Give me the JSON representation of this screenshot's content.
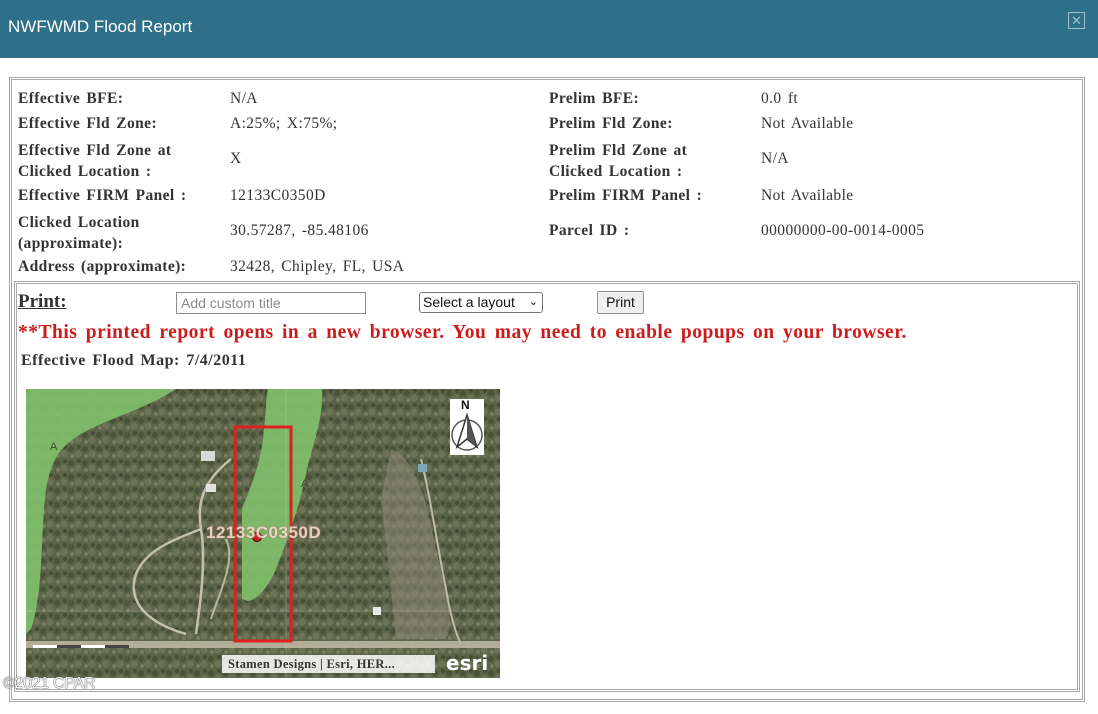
{
  "window": {
    "title": "NWFWMD Flood Report",
    "close_symbol": "✕"
  },
  "report": {
    "left": [
      {
        "label": "Effective BFE:",
        "value": "N/A"
      },
      {
        "label": "Effective Fld Zone:",
        "value": "A:25%; X:75%;"
      },
      {
        "label": "Effective Fld Zone at Clicked Location :",
        "label_line1": "Effective Fld Zone at",
        "label_line2": "Clicked Location :",
        "value": "X"
      },
      {
        "label": "Effective FIRM Panel :",
        "value": "12133C0350D"
      },
      {
        "label": "Clicked Location (approximate):",
        "label_line1": "Clicked Location",
        "label_line2": "(approximate):",
        "value": "30.57287, -85.48106"
      },
      {
        "label": "Address (approximate):",
        "value": "32428, Chipley, FL, USA"
      }
    ],
    "right": [
      {
        "label": "Prelim BFE:",
        "value": "0.0 ft"
      },
      {
        "label": "Prelim Fld Zone:",
        "value": "Not Available"
      },
      {
        "label": "Prelim Fld Zone at Clicked Location :",
        "label_line1": "Prelim Fld Zone at",
        "label_line2": "Clicked Location :",
        "value": "N/A"
      },
      {
        "label": "Prelim FIRM Panel :",
        "value": "Not Available"
      },
      {
        "label": "Parcel ID :",
        "value": "00000000-00-0014-0005"
      }
    ]
  },
  "print": {
    "label": "Print:",
    "title_placeholder": "Add custom title",
    "layout_selected": "Select a layout",
    "button_label": "Print",
    "warning": "**This printed report opens in a new browser. You may need to enable popups on your browser."
  },
  "map": {
    "heading": "Effective Flood Map: 7/4/2011",
    "panel_label": "12133C0350D",
    "zone_labels": [
      "A",
      "A"
    ],
    "north_label": "N",
    "attribution": "Stamen Designs | Esri, HER...",
    "esri_logo": "esri",
    "colors": {
      "flood_zone": "#7fbf6a",
      "parcel_outline": "#e02020",
      "marker": "#d21f1f"
    }
  },
  "footer": {
    "copyright": "©2021 CPAR"
  }
}
